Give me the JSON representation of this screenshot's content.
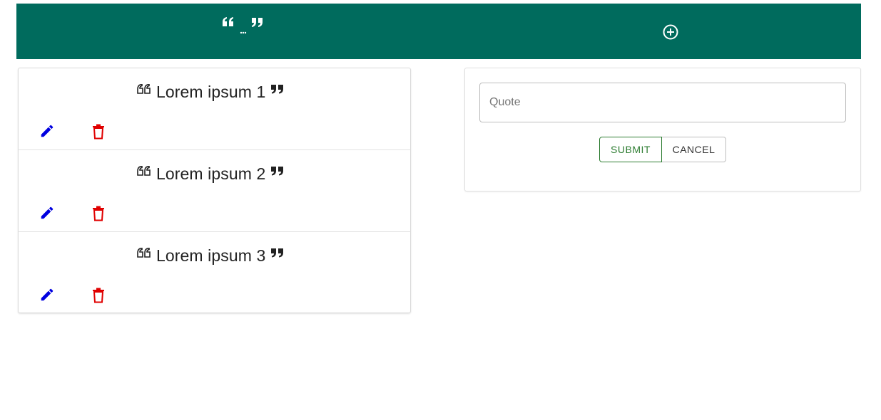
{
  "header": {
    "logo_icon": "quote-logo-icon",
    "add_icon": "add-circle-icon",
    "background_color": "#006b5d"
  },
  "quotes": [
    {
      "text": "Lorem ipsum 1"
    },
    {
      "text": "Lorem ipsum 2"
    },
    {
      "text": "Lorem ipsum 3"
    }
  ],
  "actions": {
    "edit_icon": "pencil-icon",
    "delete_icon": "trash-icon",
    "edit_color": "#0000e0",
    "delete_color": "#e00000"
  },
  "form": {
    "input_placeholder": "Quote",
    "input_value": "",
    "submit_label": "SUBMIT",
    "cancel_label": "CANCEL",
    "submit_color": "#2e7d32"
  }
}
